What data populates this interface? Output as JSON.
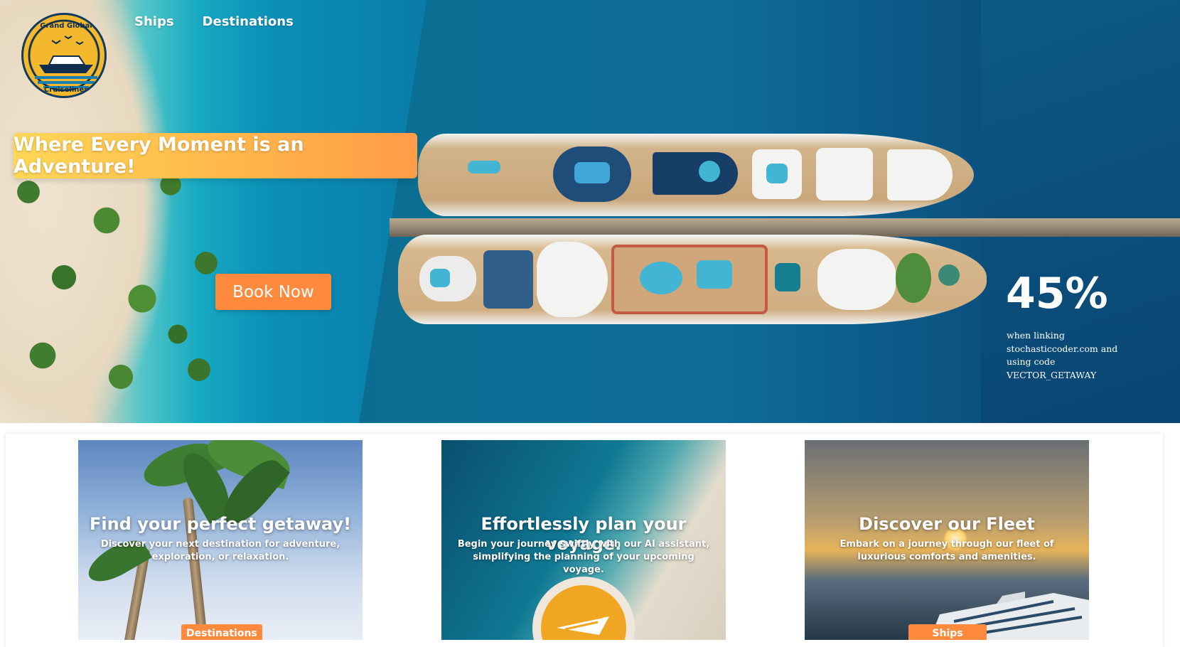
{
  "brand": {
    "name_top": "Grand Global",
    "name_bottom": "Cruiselines"
  },
  "nav": {
    "ships": "Ships",
    "destinations": "Destinations"
  },
  "hero": {
    "tagline": "Where Every Moment is an Adventure!",
    "cta": "Book Now"
  },
  "promo": {
    "percent": "45%",
    "text": "when linking stochasticcoder.com and using code VECTOR_GETAWAY"
  },
  "cards": [
    {
      "title": "Find your perfect getaway!",
      "subtitle": "Discover your next destination for adventure, exploration, or relaxation.",
      "button": "Destinations"
    },
    {
      "title": "Effortlessly plan your voyage.",
      "subtitle": "Begin your journey swiftly with our AI assistant, simplifying the planning of your upcoming voyage."
    },
    {
      "title": "Discover our Fleet",
      "subtitle": "Embark on a journey through our fleet of luxurious comforts and amenities.",
      "button": "Ships"
    }
  ],
  "colors": {
    "accent": "#ff8a3d",
    "tagline_start": "#ffd757",
    "tagline_end": "#ff9c47",
    "logo_gold": "#f3b82c",
    "logo_navy": "#0d2e4e"
  },
  "icons": [
    "ship-logo-icon",
    "boat-icon"
  ]
}
